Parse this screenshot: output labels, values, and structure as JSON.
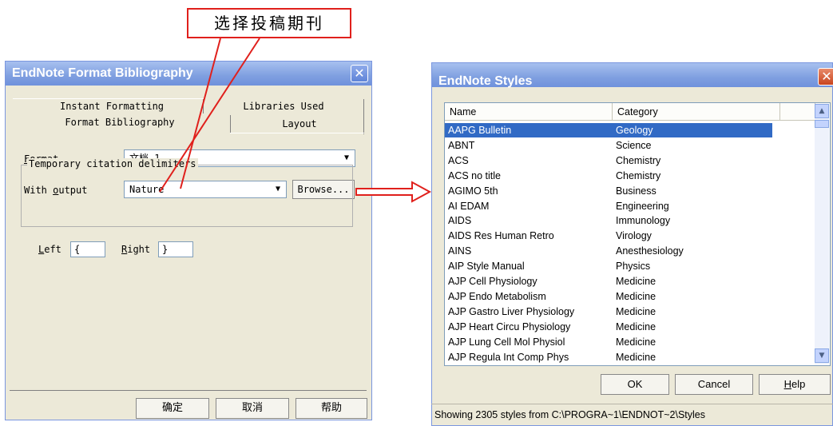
{
  "annotation": {
    "callout_text": "选择投稿期刊",
    "line_color": "#e0201c"
  },
  "format_dialog": {
    "title": "EndNote Format Bibliography",
    "close_icon": "close-icon",
    "tabs": [
      "Instant Formatting",
      "Libraries Used",
      "Format Bibliography",
      "Layout"
    ],
    "format_label_first": "F",
    "format_label_rest": "ormat",
    "format_value": "文档 1",
    "output_label_pre": "With ",
    "output_label_ul": "o",
    "output_label_post": "utput",
    "output_value": "Nature",
    "browse_label": "Browse...",
    "delimiters_group": "Temporary citation delimiters",
    "left_label_first": "L",
    "left_label_rest": "eft",
    "left_value": "{",
    "right_label_first": "R",
    "right_label_rest": "ight",
    "right_value": "}",
    "ok_label": "确定",
    "cancel_label": "取消",
    "help_label": "帮助"
  },
  "styles_dialog": {
    "title": "EndNote Styles",
    "columns": [
      "Name",
      "Category"
    ],
    "rows": [
      {
        "name": "AAPG Bulletin",
        "category": "Geology"
      },
      {
        "name": "ABNT",
        "category": "Science"
      },
      {
        "name": "ACS",
        "category": "Chemistry"
      },
      {
        "name": "ACS no title",
        "category": "Chemistry"
      },
      {
        "name": "AGIMO 5th",
        "category": "Business"
      },
      {
        "name": "AI EDAM",
        "category": "Engineering"
      },
      {
        "name": "AIDS",
        "category": "Immunology"
      },
      {
        "name": "AIDS Res Human Retro",
        "category": "Virology"
      },
      {
        "name": "AINS",
        "category": "Anesthesiology"
      },
      {
        "name": "AIP Style Manual",
        "category": "Physics"
      },
      {
        "name": "AJP Cell Physiology",
        "category": "Medicine"
      },
      {
        "name": "AJP Endo Metabolism",
        "category": "Medicine"
      },
      {
        "name": "AJP Gastro Liver Physiology",
        "category": "Medicine"
      },
      {
        "name": "AJP Heart Circu Physiology",
        "category": "Medicine"
      },
      {
        "name": "AJP Lung Cell Mol Physiol",
        "category": "Medicine"
      },
      {
        "name": "AJP Regula Int Comp Phys",
        "category": "Medicine"
      }
    ],
    "selected_index": 0,
    "ok_label": "OK",
    "cancel_label": "Cancel",
    "help_label_first": "H",
    "help_label_rest": "elp",
    "status_text": "Showing 2305 styles from C:\\PROGRA~1\\ENDNOT~2\\Styles"
  }
}
